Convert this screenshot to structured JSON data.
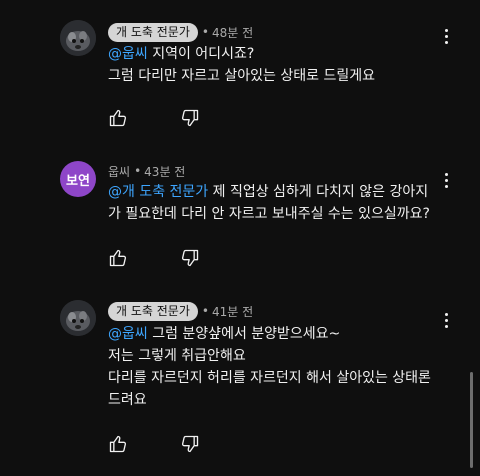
{
  "comments": [
    {
      "author": "개 도축 전문가",
      "author_style": "chip",
      "time": "48분 전",
      "avatar_icon": "dog-photo-avatar",
      "lines": [
        {
          "mention": "@웁씨",
          "text": " 지역이 어디시죠?"
        },
        {
          "mention": "",
          "text": "그럼 다리만 자르고 살아있는 상태로 드릴게요"
        }
      ]
    },
    {
      "author": "웁씨",
      "author_style": "plain",
      "time": "43분 전",
      "avatar_text": "보연",
      "avatar_color": "#8e46c8",
      "lines": [
        {
          "mention": "@개 도축 전문가",
          "text": " 제 직업상 심하게 다치지 않은 강아지"
        },
        {
          "mention": "",
          "text": "가 필요한데 다리 안 자르고 보내주실 수는 있으실까요?"
        }
      ]
    },
    {
      "author": "개 도축 전문가",
      "author_style": "chip",
      "time": "41분 전",
      "avatar_icon": "dog-photo-avatar",
      "lines": [
        {
          "mention": "@웁씨",
          "text": " 그럼 분양샾에서 분양받으세요~"
        },
        {
          "mention": "",
          "text": "저는 그렇게 취급안해요"
        },
        {
          "mention": "",
          "text": "다리를 자르던지 허리를 자르던지 해서 살아있는 상태론"
        },
        {
          "mention": "",
          "text": "드려요"
        }
      ]
    }
  ],
  "icons": {
    "like": "thumbs-up-icon",
    "dislike": "thumbs-down-icon",
    "menu": "more-vert-icon"
  },
  "colors": {
    "background": "#0f0f0f",
    "mention": "#3ea6ff",
    "chip_bg": "#d5d5d5",
    "avatar_purple": "#8e46c8"
  }
}
